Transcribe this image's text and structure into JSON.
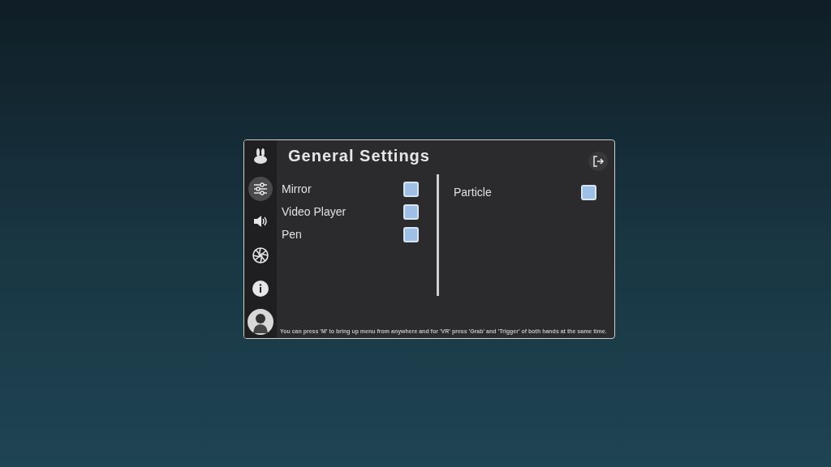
{
  "panel": {
    "title": "General Settings",
    "sidebar": [
      {
        "kind": "logo",
        "selected": false
      },
      {
        "kind": "sliders",
        "selected": true
      },
      {
        "kind": "speaker",
        "selected": false
      },
      {
        "kind": "aperture",
        "selected": false
      },
      {
        "kind": "info",
        "selected": false
      },
      {
        "kind": "avatar",
        "selected": false
      }
    ],
    "columns": [
      [
        {
          "label": "Mirror",
          "checked": false
        },
        {
          "label": "Video Player",
          "checked": false
        },
        {
          "label": "Pen",
          "checked": false
        }
      ],
      [
        {
          "label": "Particle",
          "checked": false
        }
      ]
    ],
    "footer": "You can press 'M' to bring up menu from anywhere and for 'VR' press 'Grab' and 'Trigger' of both hands at the same time."
  }
}
